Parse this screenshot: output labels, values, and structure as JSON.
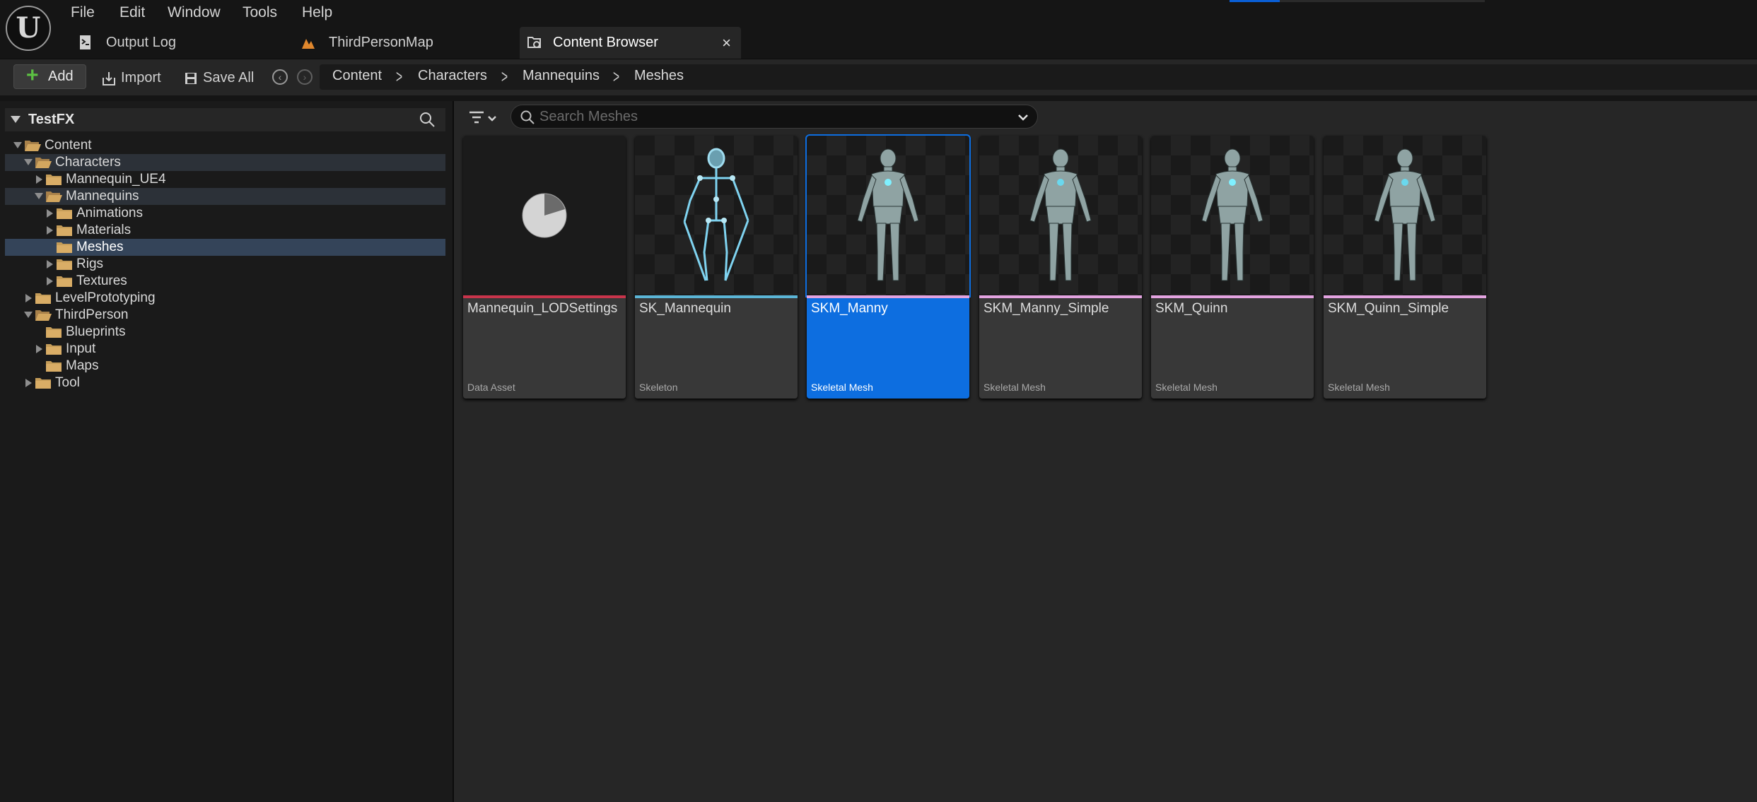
{
  "menu": {
    "logo_icon": "unreal-engine-logo",
    "items": [
      "File",
      "Edit",
      "Window",
      "Tools",
      "Help"
    ]
  },
  "tabs": [
    {
      "label": "Output Log",
      "icon": "output-log-icon"
    },
    {
      "label": "ThirdPersonMap",
      "icon": "level-icon"
    },
    {
      "label": "Content Browser",
      "icon": "content-browser-icon",
      "active": true
    }
  ],
  "tab_close": "×",
  "toolbar": {
    "add_label": "Add",
    "import_label": "Import",
    "save_all_label": "Save All",
    "breadcrumb": [
      "Content",
      "Characters",
      "Mannequins",
      "Meshes"
    ]
  },
  "tree": {
    "root_label": "TestFX",
    "rows": [
      {
        "label": "Content",
        "expanded": true
      },
      {
        "label": "Characters",
        "expanded": true
      },
      {
        "label": "Mannequin_UE4",
        "expanded": false
      },
      {
        "label": "Mannequins",
        "expanded": true
      },
      {
        "label": "Animations",
        "expanded": false
      },
      {
        "label": "Materials",
        "expanded": false
      },
      {
        "label": "Meshes",
        "selected": true
      },
      {
        "label": "Rigs",
        "expanded": false
      },
      {
        "label": "Textures",
        "expanded": false
      },
      {
        "label": "LevelPrototyping",
        "expanded": false
      },
      {
        "label": "ThirdPerson",
        "expanded": true
      },
      {
        "label": "Blueprints"
      },
      {
        "label": "Input",
        "expanded": false
      },
      {
        "label": "Maps"
      },
      {
        "label": "Tool",
        "expanded": false
      }
    ]
  },
  "search": {
    "placeholder": "Search Meshes"
  },
  "assets": [
    {
      "name": "Mannequin_LODSettings",
      "type": "Data Asset",
      "stripe": "#c8344b"
    },
    {
      "name": "SK_Mannequin",
      "type": "Skeleton",
      "stripe": "#5bb5d6"
    },
    {
      "name": "SKM_Manny",
      "type": "Skeletal Mesh",
      "stripe": "#e3a3e0",
      "selected": true
    },
    {
      "name": "SKM_Manny_Simple",
      "type": "Skeletal Mesh",
      "stripe": "#e3a3e0"
    },
    {
      "name": "SKM_Quinn",
      "type": "Skeletal Mesh",
      "stripe": "#e3a3e0"
    },
    {
      "name": "SKM_Quinn_Simple",
      "type": "Skeletal Mesh",
      "stripe": "#e3a3e0"
    }
  ],
  "colors": {
    "accent": "#0d6ee0",
    "selection": "#344459",
    "add_green": "#5cc043"
  }
}
